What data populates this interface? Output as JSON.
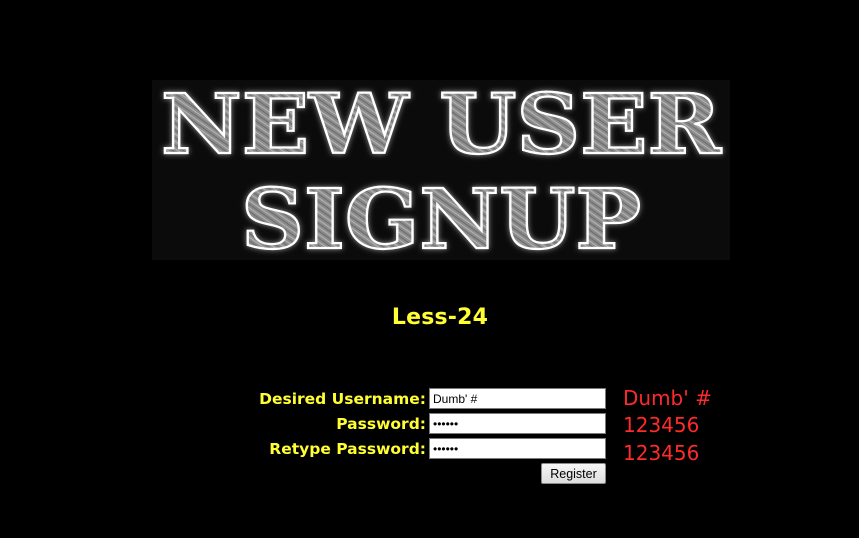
{
  "banner": {
    "line1": "NEW USER",
    "line2": "SIGNUP"
  },
  "level_title": "Less-24",
  "form": {
    "username_label": "Desired Username:",
    "username_value": "Dumb' #",
    "password_label": "Password:",
    "password_value": "123456",
    "retype_label": "Retype Password:",
    "retype_value": "123456",
    "register_label": "Register"
  },
  "echo": {
    "username": "Dumb' #",
    "password": "123456",
    "retype": "123456"
  },
  "colors": {
    "background": "#000000",
    "label": "#ffff33",
    "echo": "#ff2a2a"
  }
}
